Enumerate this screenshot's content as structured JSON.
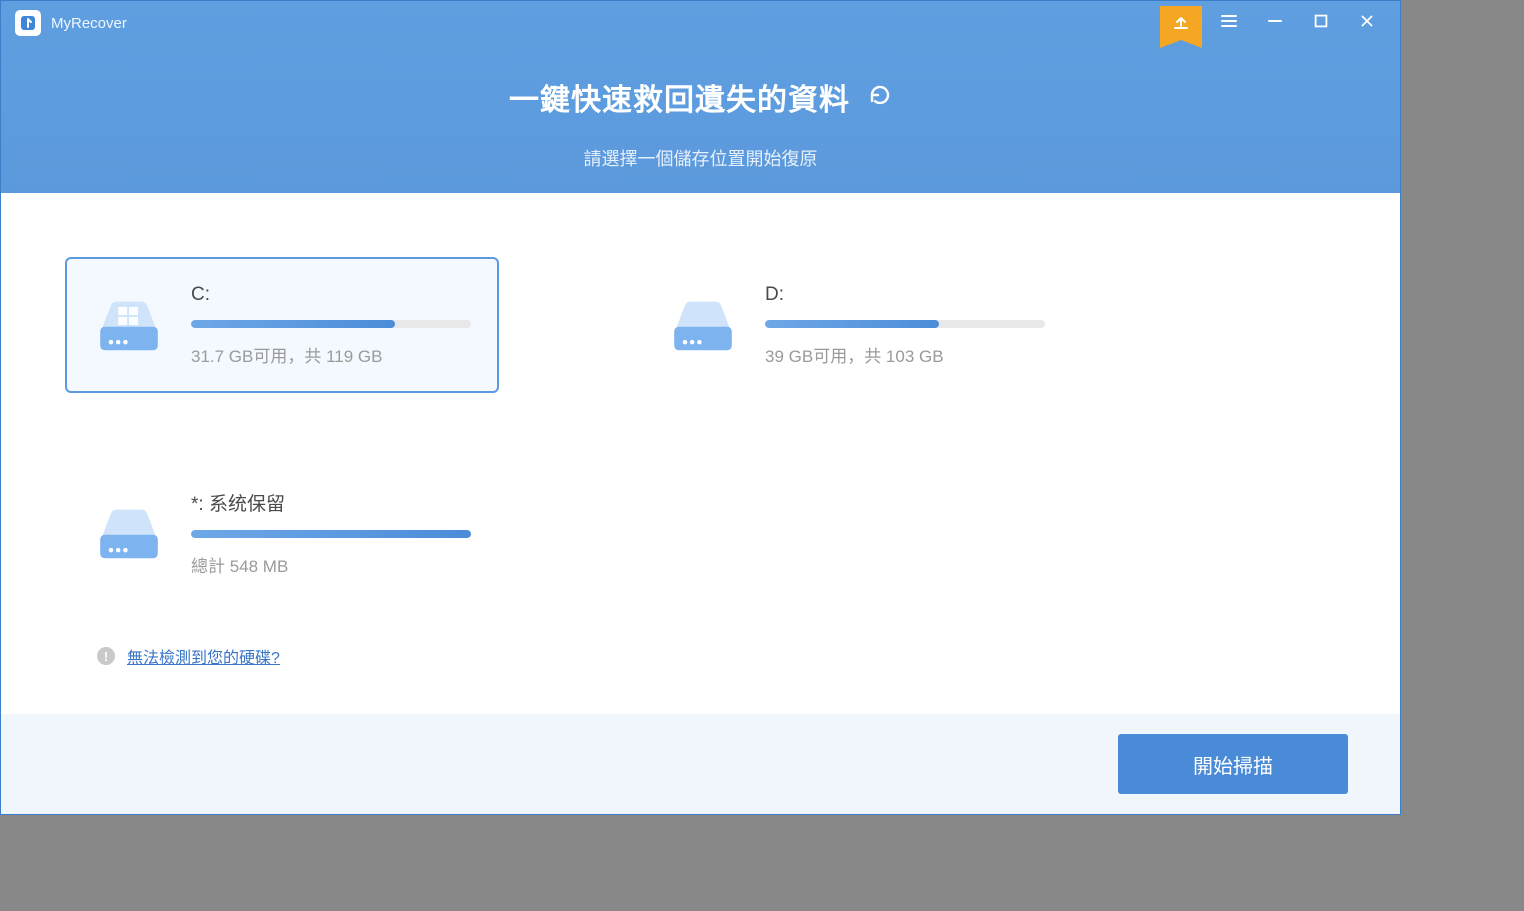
{
  "app": {
    "name": "MyRecover"
  },
  "header": {
    "title": "一鍵快速救回遺失的資料",
    "subtitle": "請選擇一個儲存位置開始復原"
  },
  "drives": [
    {
      "label": "C:",
      "subtext": "31.7 GB可用，共 119 GB",
      "used_pct": 73,
      "selected": true,
      "is_windows": true
    },
    {
      "label": "D:",
      "subtext": "39 GB可用，共 103 GB",
      "used_pct": 62,
      "selected": false,
      "is_windows": false
    },
    {
      "label": "*: 系统保留",
      "subtext": "總計 548 MB",
      "used_pct": 100,
      "selected": false,
      "is_windows": false
    }
  ],
  "help": {
    "link_text": "無法檢測到您的硬碟?"
  },
  "footer": {
    "scan_button": "開始掃描"
  },
  "colors": {
    "primary": "#4a8bd8",
    "header": "#5e9de0",
    "accent": "#f5a623"
  }
}
